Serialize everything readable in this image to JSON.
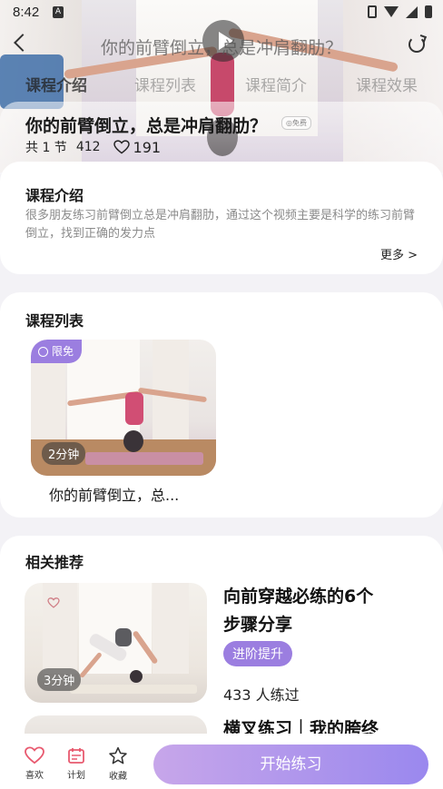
{
  "status_bar": {
    "time": "8:42",
    "app_icon_letter": "A"
  },
  "header": {
    "title": "你的前臂倒立，总是冲肩翻肋？"
  },
  "tabs": [
    {
      "label": "课程介绍",
      "active": true
    },
    {
      "label": "课程列表",
      "active": false
    },
    {
      "label": "课程简介",
      "active": false
    },
    {
      "label": "课程效果",
      "active": false
    }
  ],
  "course": {
    "title": "你的前臂倒立，总是冲肩翻肋？",
    "free_tag": "◎免费",
    "lesson_count": "共 1 节",
    "views": "412",
    "likes": "191"
  },
  "intro": {
    "heading": "课程介绍",
    "text": "很多朋友练习前臂倒立总是冲肩翻肋，通过这个视频主要是科学的练习前臂倒立，找到正确的发力点",
    "more_label": "更多 >"
  },
  "lesson_list": {
    "heading": "课程列表",
    "items": [
      {
        "tag": "限免",
        "duration": "2分钟",
        "title": "你的前臂倒立，总..."
      }
    ]
  },
  "recommended": {
    "heading": "相关推荐",
    "items": [
      {
        "title_line1": "向前穿越必练的6个",
        "title_line2": "步骤分享",
        "level": "进阶提升",
        "learners": "433 人练过",
        "duration": "3分钟"
      },
      {
        "title_line1": "横叉练习｜我的胯终",
        "title_line2": "",
        "level": "",
        "learners": "",
        "duration": ""
      }
    ]
  },
  "bottom_bar": {
    "like_label": "喜欢",
    "plan_label": "计划",
    "collect_label": "收藏",
    "start_label": "开始练习"
  },
  "colors": {
    "accent": "#9b7ee0",
    "heart": "#e8596f",
    "start_gradient_from": "#c7a6ea",
    "start_gradient_to": "#9a88ee"
  }
}
